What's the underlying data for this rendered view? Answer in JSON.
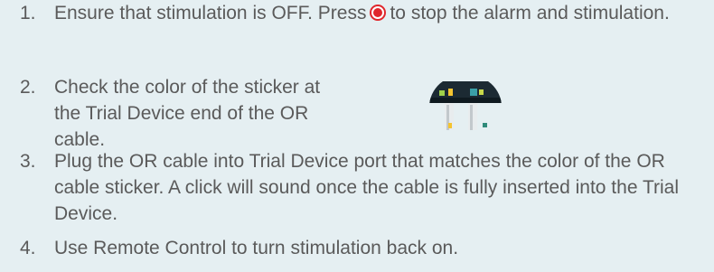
{
  "steps": [
    {
      "number": "1.",
      "text_before_icon": "Ensure that stimulation is OFF.  Press",
      "icon": "stop-button-icon",
      "text_after_icon": "to stop the alarm and stimulation."
    },
    {
      "number": "2.",
      "text": "Check the color of the sticker at the Trial Device end of the OR cable.",
      "image": "or-cable-sticker-image"
    },
    {
      "number": "3.",
      "text": "Plug the OR cable into Trial Device port that matches the color of the OR cable sticker. A click will sound once the cable is fully inserted into the Trial Device."
    },
    {
      "number": "4.",
      "text": "Use Remote Control to turn stimulation back on."
    }
  ],
  "colors": {
    "background": "#e5eff2",
    "text": "#5a5a5a",
    "stop_icon": "#e0262b"
  }
}
